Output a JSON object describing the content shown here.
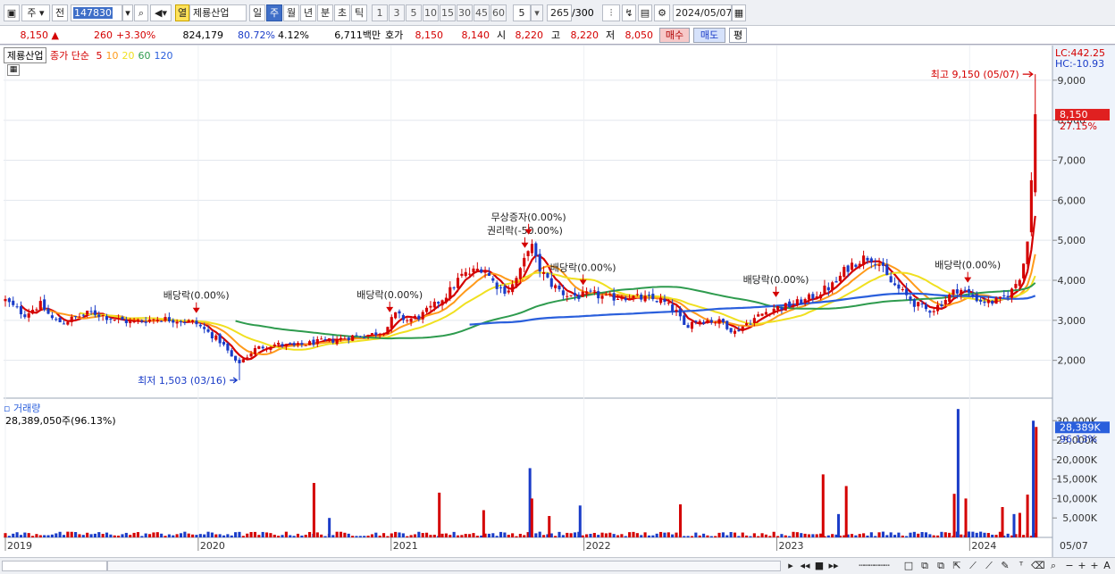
{
  "toolbar": {
    "type_select": "주",
    "prev_label": "전",
    "code": "147830",
    "view_label": "열",
    "stock_name": "제룡산업",
    "periods": [
      "일",
      "주",
      "월",
      "년",
      "분",
      "초",
      "틱"
    ],
    "active_period": "주",
    "intervals": [
      "1",
      "3",
      "5",
      "10",
      "15",
      "30",
      "45",
      "60"
    ],
    "interval_value": "5",
    "count": "265",
    "count_max": "/300",
    "date": "2024/05/07"
  },
  "quote": {
    "price": "8,150",
    "arrow": "▲",
    "change": "260",
    "change_pct": "+3.30%",
    "volume": "824,179",
    "ratio": "80.72%",
    "turnover_pct": "4.12%",
    "amount": "6,711백만",
    "bid_label": "호가",
    "bid1": "8,150",
    "bid2": "8,140",
    "open_label": "시",
    "open": "8,220",
    "high_label": "고",
    "high": "8,220",
    "low_label": "저",
    "low": "8,050",
    "buy_label": "매수",
    "sell_label": "매도",
    "avg_label": "평"
  },
  "legend": {
    "name": "제룡산업",
    "close_label": "종가 단순",
    "ma": [
      "5",
      "10",
      "20",
      "60",
      "120"
    ]
  },
  "colors": {
    "up": "#d40000",
    "down": "#1a3cc8",
    "ma5": "#d40000",
    "ma10": "#ff9a1a",
    "ma20": "#f0e020",
    "ma60": "#2e9b4e",
    "ma120": "#2a5fdc"
  },
  "scale": {
    "lc": "LC:442.25",
    "hc": "HC:-10.93"
  },
  "chart_data": {
    "type": "candlestick",
    "x": [
      "2019",
      "2020",
      "2021",
      "2022",
      "2023",
      "2024",
      "05/07"
    ],
    "price_ticks": [
      "2,000",
      "3,000",
      "4,000",
      "5,000",
      "6,000",
      "7,000",
      "8,000",
      "9,000"
    ],
    "price_tick_values": [
      2000,
      3000,
      4000,
      5000,
      6000,
      7000,
      8000,
      9000
    ],
    "ylim": [
      1100,
      9800
    ],
    "current": {
      "price": "8,150",
      "pct": "27.15%",
      "value": 8150
    },
    "high_note": "최고 9,150 (05/07)",
    "high_value": 9150,
    "low_note": "최저 1,503 (03/16)",
    "low_value": 1503,
    "events": [
      {
        "label": "배당락(0.00%)",
        "date": "2019-12-27"
      },
      {
        "label": "배당락(0.00%)",
        "date": "2020-12-28"
      },
      {
        "label": "권리락(-50.00%)",
        "date": "2021-09-10"
      },
      {
        "label": "무상증자(0.00%)",
        "date": "2021-09-17"
      },
      {
        "label": "배당락(0.00%)",
        "date": "2021-12-29"
      },
      {
        "label": "배당락(0.00%)",
        "date": "2022-12-29"
      },
      {
        "label": "배당락(0.00%)",
        "date": "2023-12-27"
      }
    ],
    "close_series": [
      [
        2019.0,
        3500
      ],
      [
        2019.05,
        3300
      ],
      [
        2019.1,
        3150
      ],
      [
        2019.18,
        3400
      ],
      [
        2019.25,
        3000
      ],
      [
        2019.3,
        2950
      ],
      [
        2019.38,
        3100
      ],
      [
        2019.45,
        3200
      ],
      [
        2019.55,
        3050
      ],
      [
        2019.65,
        2950
      ],
      [
        2019.72,
        3000
      ],
      [
        2019.8,
        3050
      ],
      [
        2019.9,
        3000
      ],
      [
        2019.98,
        2950
      ],
      [
        2020.05,
        2700
      ],
      [
        2020.12,
        2450
      ],
      [
        2020.2,
        1900
      ],
      [
        2020.24,
        2050
      ],
      [
        2020.3,
        2300
      ],
      [
        2020.4,
        2400
      ],
      [
        2020.5,
        2350
      ],
      [
        2020.6,
        2450
      ],
      [
        2020.7,
        2500
      ],
      [
        2020.8,
        2600
      ],
      [
        2020.9,
        2650
      ],
      [
        2020.97,
        2750
      ],
      [
        2021.02,
        3150
      ],
      [
        2021.08,
        3000
      ],
      [
        2021.15,
        3100
      ],
      [
        2021.22,
        3350
      ],
      [
        2021.3,
        3700
      ],
      [
        2021.36,
        4100
      ],
      [
        2021.42,
        4200
      ],
      [
        2021.48,
        4350
      ],
      [
        2021.52,
        4000
      ],
      [
        2021.58,
        3750
      ],
      [
        2021.62,
        3800
      ],
      [
        2021.68,
        4300
      ],
      [
        2021.72,
        5000
      ],
      [
        2021.76,
        4350
      ],
      [
        2021.82,
        3950
      ],
      [
        2021.9,
        3650
      ],
      [
        2021.98,
        3600
      ],
      [
        2022.05,
        3650
      ],
      [
        2022.12,
        3550
      ],
      [
        2022.2,
        3600
      ],
      [
        2022.3,
        3550
      ],
      [
        2022.4,
        3500
      ],
      [
        2022.48,
        3200
      ],
      [
        2022.52,
        2850
      ],
      [
        2022.58,
        3000
      ],
      [
        2022.65,
        3000
      ],
      [
        2022.72,
        2950
      ],
      [
        2022.78,
        2700
      ],
      [
        2022.85,
        2950
      ],
      [
        2022.92,
        3150
      ],
      [
        2022.98,
        3300
      ],
      [
        2023.05,
        3350
      ],
      [
        2023.15,
        3500
      ],
      [
        2023.22,
        3700
      ],
      [
        2023.3,
        3900
      ],
      [
        2023.36,
        4300
      ],
      [
        2023.42,
        4500
      ],
      [
        2023.48,
        4600
      ],
      [
        2023.52,
        4500
      ],
      [
        2023.58,
        4000
      ],
      [
        2023.65,
        3700
      ],
      [
        2023.72,
        3400
      ],
      [
        2023.78,
        3250
      ],
      [
        2023.82,
        3300
      ],
      [
        2023.88,
        3550
      ],
      [
        2023.94,
        3800
      ],
      [
        2024.0,
        3650
      ],
      [
        2024.05,
        3500
      ],
      [
        2024.1,
        3450
      ],
      [
        2024.16,
        3500
      ],
      [
        2024.22,
        3750
      ],
      [
        2024.27,
        4200
      ],
      [
        2024.3,
        5000
      ],
      [
        2024.32,
        6300
      ],
      [
        2024.34,
        8150
      ]
    ],
    "ma_labels": [
      "5",
      "10",
      "20",
      "60",
      "120"
    ],
    "volume": {
      "label": "거래량",
      "info": "28,389,050주(96.13%)",
      "current": "28,389K",
      "pct": "96.13%",
      "current_value": 28389,
      "ticks": [
        "5,000K",
        "10,000K",
        "15,000K",
        "20,000K",
        "25,000K",
        "30,000K"
      ],
      "tick_values": [
        5000,
        10000,
        15000,
        20000,
        25000,
        30000
      ],
      "ylim": [
        0,
        33500
      ],
      "spikes": [
        [
          2020.6,
          14000
        ],
        [
          2020.68,
          5000
        ],
        [
          2021.25,
          11500
        ],
        [
          2021.48,
          7000
        ],
        [
          2021.72,
          17800
        ],
        [
          2021.73,
          10000
        ],
        [
          2021.82,
          5500
        ],
        [
          2021.98,
          8200
        ],
        [
          2022.5,
          8500
        ],
        [
          2023.24,
          16200
        ],
        [
          2023.32,
          6000
        ],
        [
          2023.36,
          13200
        ],
        [
          2023.92,
          11200
        ],
        [
          2023.94,
          33000
        ],
        [
          2023.98,
          10000
        ],
        [
          2024.17,
          7800
        ],
        [
          2024.23,
          6000
        ],
        [
          2024.26,
          6300
        ],
        [
          2024.3,
          11000
        ],
        [
          2024.33,
          30000
        ],
        [
          2024.345,
          28389
        ]
      ]
    }
  }
}
